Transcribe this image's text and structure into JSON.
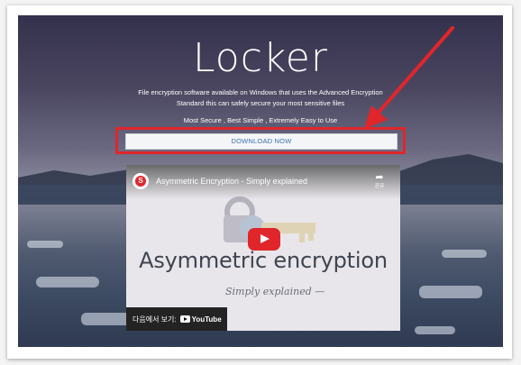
{
  "hero": {
    "title": "Locker",
    "description_line1": "File encryption software available on Windows that uses the Advanced Encryption",
    "description_line2": "Standard this can safely secure your most sensitive files",
    "tagline": "Most Secure , Best Simple , Extremely Easy to Use",
    "download_label": "DOWNLOAD NOW"
  },
  "video": {
    "title": "Asymmetric Encryption - Simply explained",
    "share_label": "공유",
    "thumbnail_text": "Asymmetric encryption",
    "thumbnail_subtext": "Simply explained —",
    "watch_on_label": "다음에서 보기:",
    "youtube_label": "YouTube",
    "channel_initial": "S"
  },
  "colors": {
    "highlight": "#e0262b",
    "button_text": "#3c72b3"
  },
  "icons": [
    "share-icon",
    "play-icon",
    "youtube-logo-icon",
    "channel-avatar-icon",
    "red-arrow-annotation"
  ]
}
